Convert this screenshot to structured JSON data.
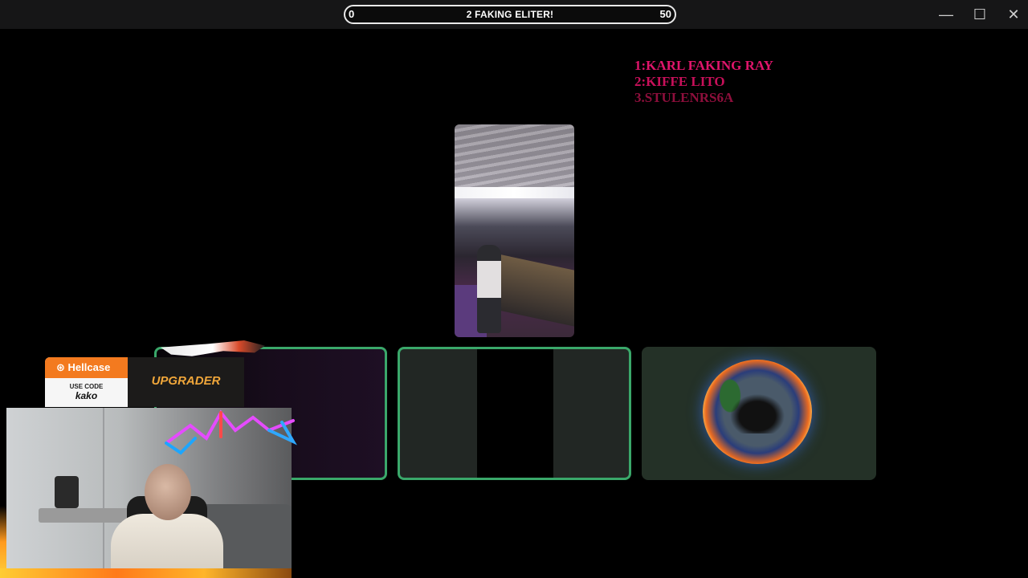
{
  "window": {
    "progress": {
      "left_value": "0",
      "right_value": "50",
      "title": "2 FAKING ELITER!",
      "fraction": 0.0
    },
    "controls": {
      "minimize": "—",
      "maximize": "☐",
      "close": "✕"
    }
  },
  "leaderboard": {
    "entries": [
      {
        "text": "1:KARL FAKING RAY",
        "color": "#e0156b"
      },
      {
        "text": "2:KIFFE LITO",
        "color": "#c8105a"
      },
      {
        "text": "3.STULENRS6A",
        "color": "#8e0f3c"
      }
    ]
  },
  "sponsor": {
    "brand": "Hellcase",
    "use_code_label": "USE CODE",
    "code": "kako",
    "upgrader_label": "UPGRADER"
  },
  "colors": {
    "slot_border": "#3aa86a",
    "titlebar_bg": "#161617",
    "accent_orange": "#f37a1f"
  },
  "icons": {
    "brand": "hellcase-logo-icon",
    "minimize": "minimize-icon",
    "maximize": "maximize-icon",
    "close": "close-icon"
  }
}
